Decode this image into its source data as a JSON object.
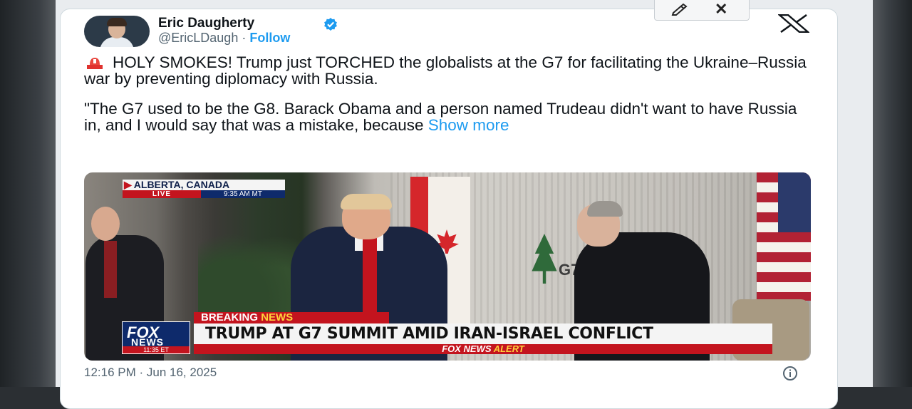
{
  "toolbar": {
    "edit_icon": "pencil-icon",
    "close_label": "✕"
  },
  "author": {
    "name": "Eric Daugherty",
    "handle": "@EricLDaugh",
    "separator": "·",
    "follow_label": "Follow",
    "verified": true
  },
  "tweet": {
    "line1": "HOLY SMOKES! Trump just TORCHED the globalists at the G7 for facilitating the Ukraine–Russia war by preventing diplomacy with Russia.",
    "line2": "\"The G7 used to be the G8. Barack Obama and a person named Trudeau didn't want to have Russia in, and I would say that was a mistake, because ",
    "show_more": "Show more"
  },
  "media": {
    "location": "ALBERTA, CANADA",
    "live": "LIVE",
    "time": "9:35 AM MT",
    "breaking": "BREAKING",
    "breaking_news": "NEWS",
    "headline": "TRUMP AT G7 SUMMIT AMID IRAN-ISRAEL CONFLICT",
    "fox_top": "FOX",
    "fox_bottom": "NEWS",
    "fox_time": "11:35 ET",
    "alert_left": "FOX NEWS",
    "alert_right": "ALERT",
    "backdrop_text": "G7"
  },
  "footer": {
    "timestamp": "12:16 PM · Jun 16, 2025"
  },
  "colors": {
    "accent": "#1d9bf0",
    "fox_red": "#c3141e",
    "fox_blue": "#0e2a6b"
  }
}
